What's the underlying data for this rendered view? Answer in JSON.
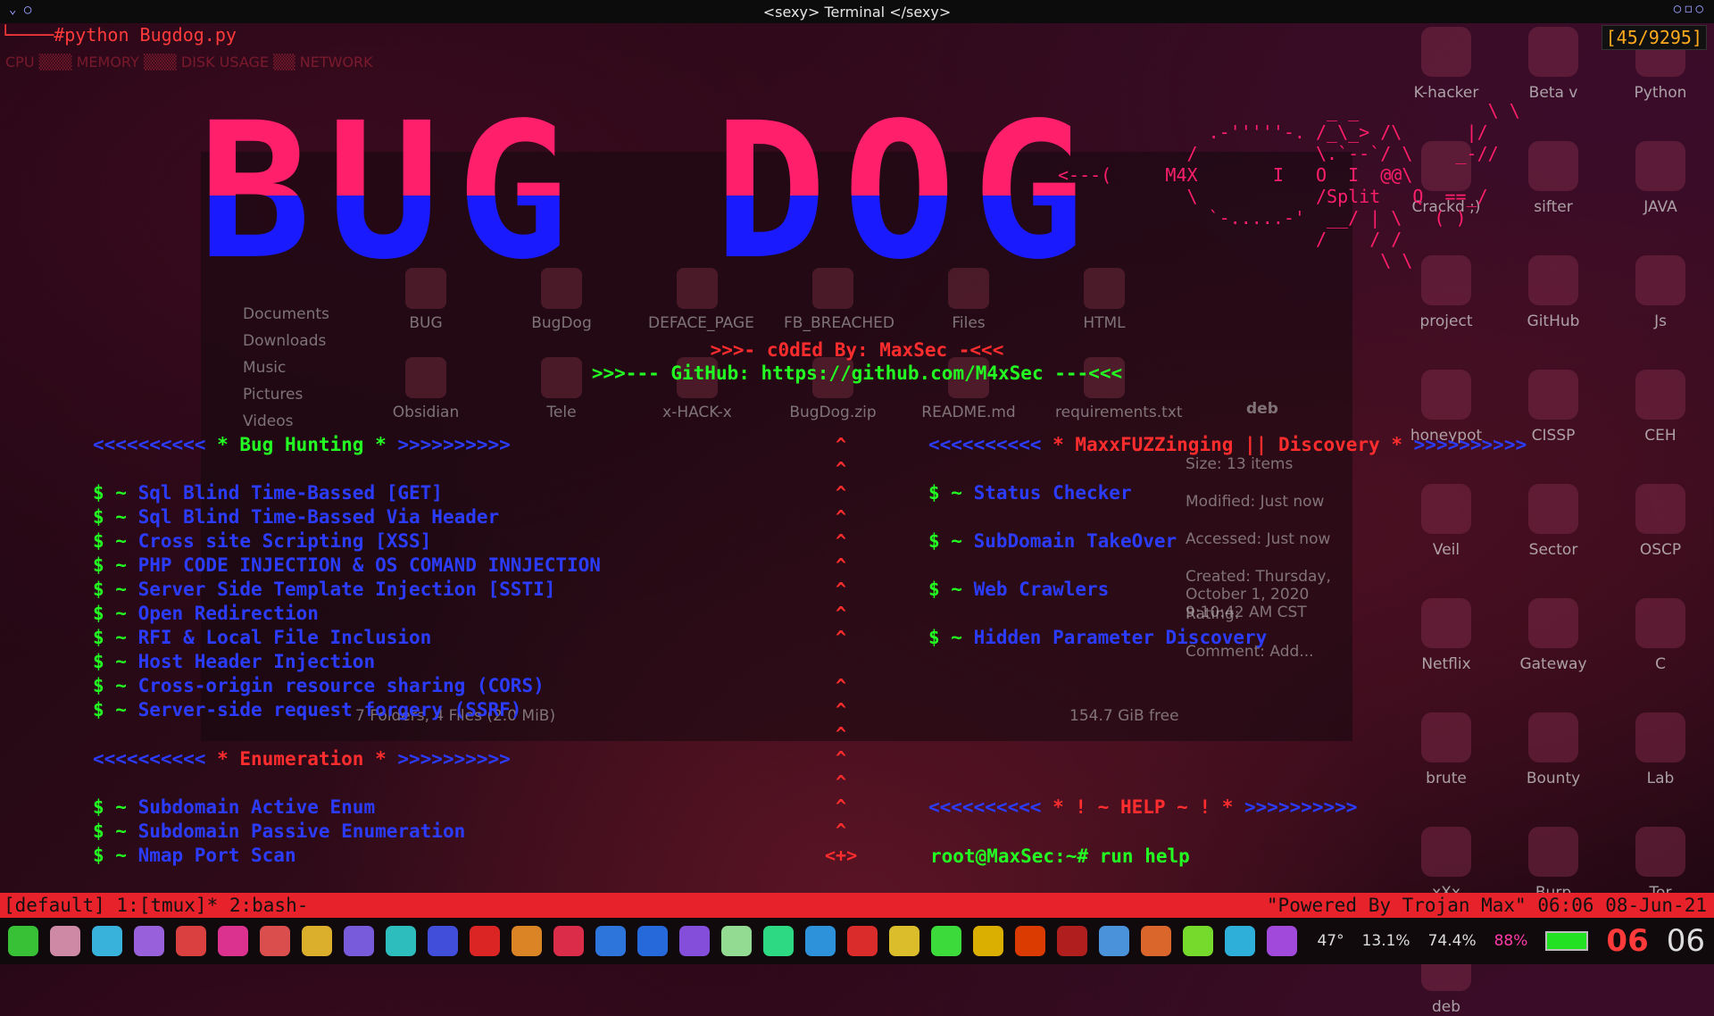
{
  "window": {
    "title": "<sexy> Terminal </sexy>",
    "counter": "[45/9295]"
  },
  "terminal": {
    "command_prompt": "└────#python Bugdog.py",
    "banner": "BUG DOG",
    "ascii_dog": "                         _ _            \\ \\\n              .-'''''-. /_\\_> /\\      |/\n            /           \\.`--`/ \\    _-//\n<---(     M4X       I   O  I  @@\\\n            \\           /Split   Q  ==_/\n              `-.....-'  __/ | \\   ( )\n                        /    / /\n                              \\ \\",
    "credit": ">>>- c0dEd By: MaxSec -<<<",
    "github": ">>>--- GitHub: https://github.com/M4xSec ---<<<",
    "sections": {
      "bug_hunting": {
        "left": "<<<<<<<<<<",
        "title": " * Bug Hunting * ",
        "right": ">>>>>>>>>>"
      },
      "enumeration": {
        "left": "<<<<<<<<<<",
        "title": " * Enumeration * ",
        "right": ">>>>>>>>>>"
      },
      "fuzzing": {
        "left": "<<<<<<<<<<",
        "title": " * MaxxFUZZinging || Discovery * ",
        "right": ">>>>>>>>>>"
      },
      "help": {
        "left": "<<<<<<<<<<",
        "title": " * ! ~ HELP ~ ! * ",
        "right": ">>>>>>>>>>"
      }
    },
    "item_prefix": "$ ~ ",
    "bug_hunting_items": [
      "Sql Blind Time-Bassed [GET]",
      "Sql Blind Time-Bassed Via Header",
      "Cross site Scripting [XSS]",
      "PHP CODE INJECTION & OS COMAND INNJECTION",
      "Server Side Template Injection [SSTI]",
      "Open Redirection",
      "RFI & Local File Inclusion",
      "Host Header Injection",
      "Cross-origin resource sharing (CORS)",
      "Server-side request forgery (SSRF)"
    ],
    "enumeration_items": [
      "Subdomain Active Enum",
      "Subdomain Passive Enumeration",
      "Nmap Port Scan"
    ],
    "fuzzing_items": [
      "Status Checker",
      "SubDomain TakeOver",
      "Web Crawlers",
      "Hidden Parameter Discovery"
    ],
    "caret": "^",
    "caret_end": "<+>",
    "root_prompt": "root@MaxSec:~# run help"
  },
  "tmux": {
    "left": "[default] 1:[tmux]* 2:bash-",
    "right": "\"Powered By Trojan Max\" 06:06 08-Jun-21"
  },
  "ghost_desktop": {
    "file_icons": [
      "BUG",
      "BugDog",
      "DEFACE_PAGE",
      "FB_BREACHED",
      "Files",
      "HTML",
      "Obsidian",
      "Tele",
      "x-HACK-x",
      "BugDog.zip",
      "README.md",
      "requirements.txt"
    ],
    "sidebar": [
      "Documents",
      "Downloads",
      "Music",
      "Pictures",
      "Videos"
    ],
    "status": "7 Folders, 4 Files (2.0 MiB)",
    "free": "154.7 GiB free",
    "props_name": "deb",
    "props": [
      "Size: 13 items",
      "Modified: Just now",
      "Accessed: Just now",
      "Created: Thursday, October 1, 2020 9:10:42 AM CST",
      "Rating:",
      "Comment: Add..."
    ]
  },
  "desktop_icons": [
    "K-hacker",
    "Beta v",
    "Python",
    "Crackd ;)",
    "sifter",
    "JAVA",
    "project",
    "GitHub",
    "Js",
    "honeypot",
    "CISSP",
    "CEH",
    "Veil",
    "Sector",
    "OSCP",
    "Netflix",
    "Gateway",
    "C",
    "brute",
    "Bounty",
    "Lab",
    "xXx",
    "Burp",
    "Tor",
    "deb"
  ],
  "tray": {
    "temp": "47°",
    "cpu": "13.1%",
    "mem": "74.4%",
    "battery": "88%",
    "clock_h": "06",
    "clock_m": "06"
  },
  "colors": {
    "banner_top": "#ff1f6a",
    "banner_bottom": "#1a1aff",
    "green": "#23ff23",
    "blue": "#2b3cff",
    "red": "#ff2d2d",
    "tmux_bar": "#e8222b"
  }
}
